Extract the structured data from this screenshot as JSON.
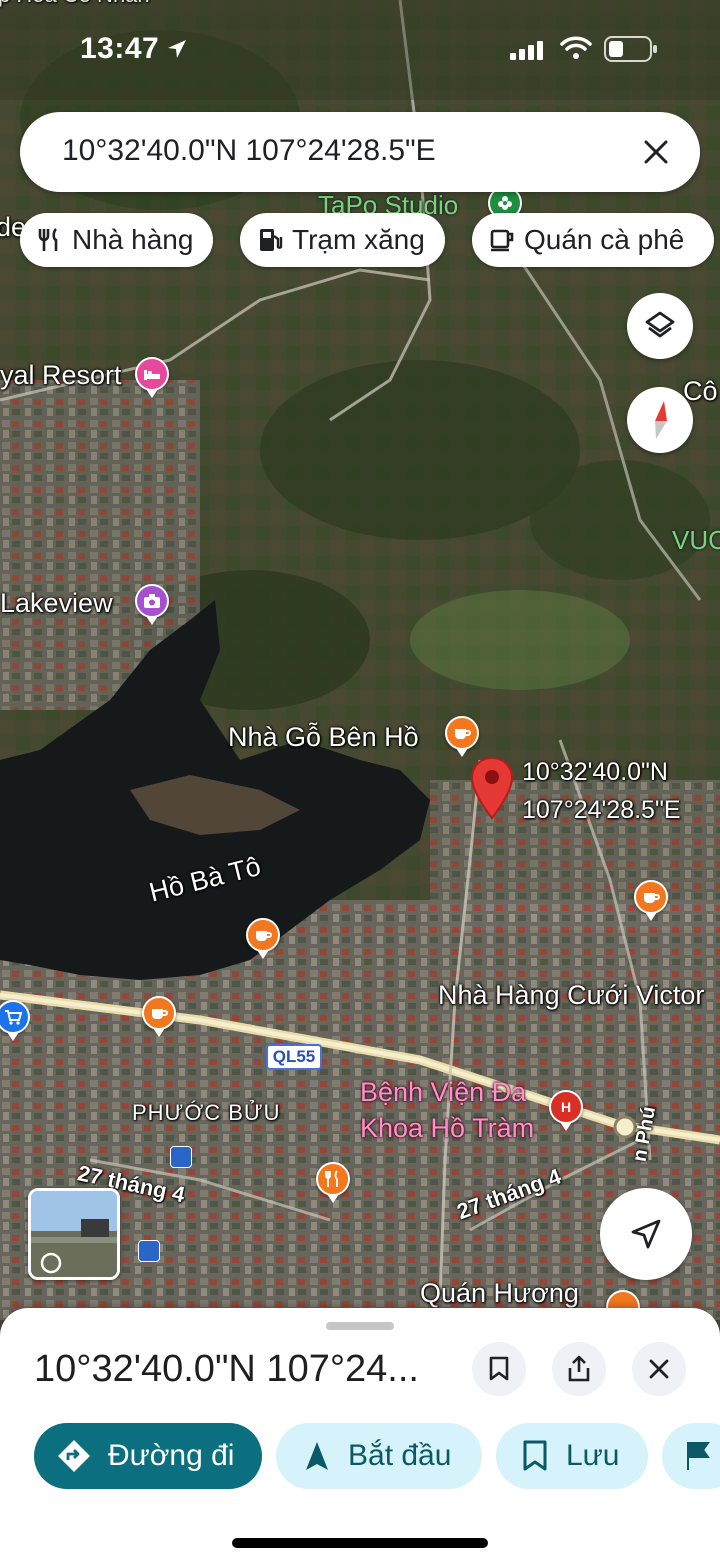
{
  "status_bar": {
    "time": "13:47"
  },
  "search": {
    "query": "10°32'40.0\"N 107°24'28.5\"E"
  },
  "chips": [
    {
      "label": "Nhà hàng",
      "icon": "restaurant-icon"
    },
    {
      "label": "Trạm xăng",
      "icon": "gas-station-icon"
    },
    {
      "label": "Quán cà phê",
      "icon": "coffee-icon"
    }
  ],
  "map": {
    "labels": {
      "resort": "yal Resort",
      "lakeview": "Lakeview",
      "tapo": "TaPo Studio",
      "nha_go": "Nhà Gỗ Bên Hồ",
      "ho_ba_to": "Hồ Bà Tô",
      "nha_hang_cuoi": "Nhà Hàng Cưới Victor",
      "hospital": "Bệnh Viện Đa\nKhoa Hồ Tràm",
      "phuoc_buu": "PHƯỚC BỬU",
      "road_27_left": "27 tháng 4",
      "road_27_right": "27 tháng 4",
      "quan_huong": "Quán Hương",
      "road_ql55": "QL55",
      "top_edge": "p Hoa Cô Nhân",
      "right_edge_top": "Cô",
      "right_edge_green": "VUC",
      "left_edge": "de",
      "road_phu": "n Phú"
    },
    "pin_coords": {
      "lat": "10°32'40.0\"N",
      "lng": "107°24'28.5\"E"
    }
  },
  "sheet": {
    "title": "10°32'40.0\"N 107°24...",
    "actions": [
      {
        "label": "Đường đi"
      },
      {
        "label": "Bắt đầu"
      },
      {
        "label": "Lưu"
      }
    ]
  },
  "colors": {
    "primary": "#0b6f7f",
    "secondary": "#d6f3fb",
    "pin_red": "#d93025",
    "poi_orange": "#f2781f"
  }
}
